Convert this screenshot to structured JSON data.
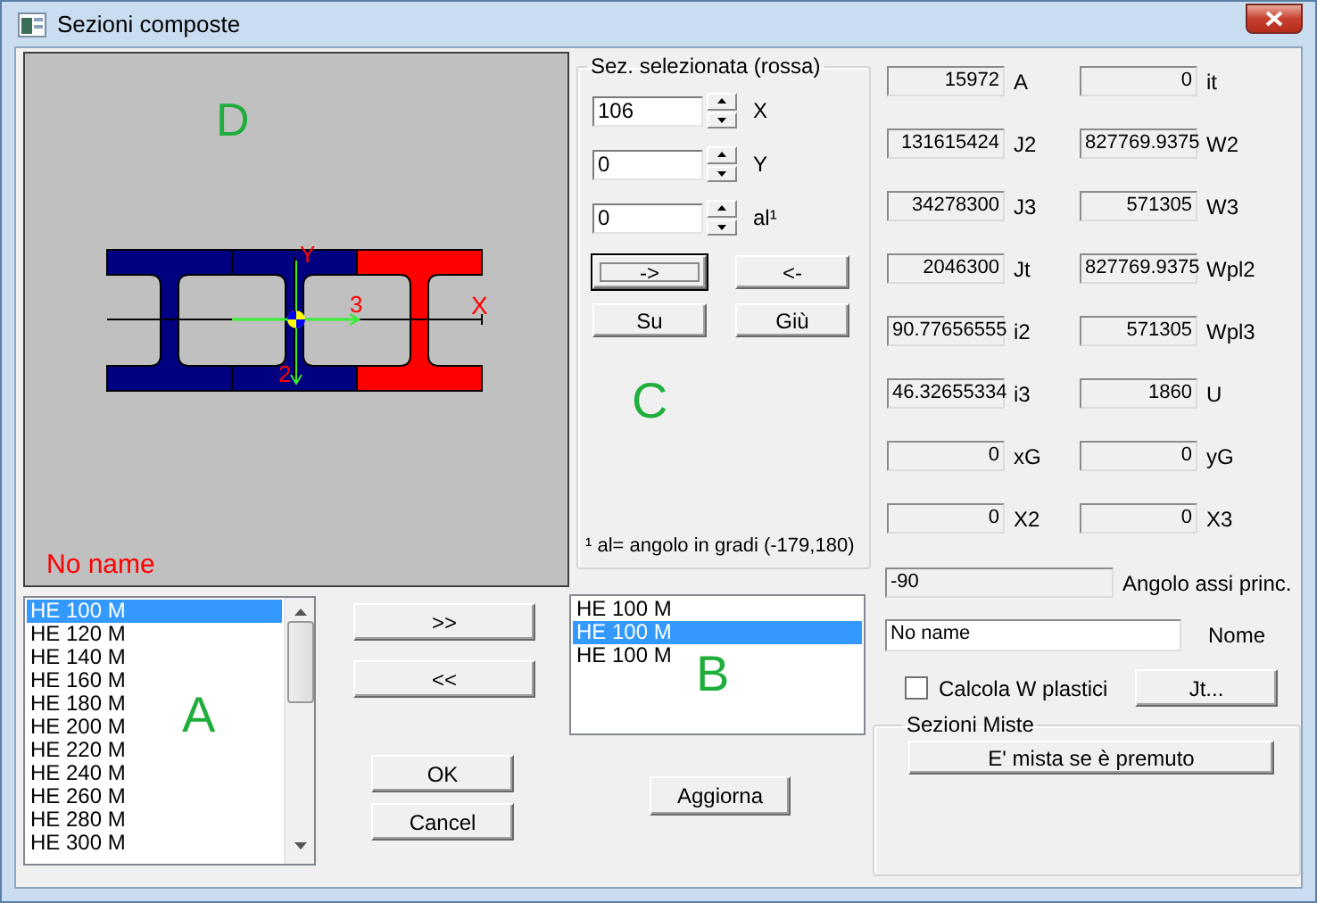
{
  "window": {
    "title": "Sezioni composte"
  },
  "drawing": {
    "letter": "D",
    "name": "No name",
    "axis_labels": {
      "x": "X",
      "y": "Y",
      "axis_3": "3",
      "axis_2": "2"
    },
    "sections": [
      {
        "selected": false
      },
      {
        "selected": false
      },
      {
        "selected": true
      }
    ]
  },
  "list_a": {
    "letter": "A",
    "items": [
      {
        "label": "HE 100 M",
        "selected": true
      },
      {
        "label": "HE 120 M",
        "selected": false
      },
      {
        "label": "HE 140 M",
        "selected": false
      },
      {
        "label": "HE 160 M",
        "selected": false
      },
      {
        "label": "HE 180 M",
        "selected": false
      },
      {
        "label": "HE 200 M",
        "selected": false
      },
      {
        "label": "HE 220 M",
        "selected": false
      },
      {
        "label": "HE 240 M",
        "selected": false
      },
      {
        "label": "HE 260 M",
        "selected": false
      },
      {
        "label": "HE 280 M",
        "selected": false
      },
      {
        "label": "HE 300 M",
        "selected": false
      }
    ]
  },
  "transfer_buttons": [
    ">>",
    "<<"
  ],
  "dialog_buttons": [
    "OK",
    "Cancel"
  ],
  "selected_section": {
    "title": "Sez. selezionata (rossa)",
    "fields": [
      {
        "value": "106",
        "label": "X"
      },
      {
        "value": "0",
        "label": "Y"
      },
      {
        "value": "0",
        "label": "al¹"
      }
    ],
    "buttons": [
      {
        "label": "->",
        "focused": true
      },
      {
        "label": "<-",
        "focused": false
      },
      {
        "label": "Su",
        "focused": false
      },
      {
        "label": "Giù",
        "focused": false
      }
    ],
    "letter": "C",
    "footnote": "¹ al= angolo in gradi (-179,180)"
  },
  "list_b": {
    "letter": "B",
    "items": [
      {
        "label": "HE 100 M",
        "selected": false
      },
      {
        "label": "HE 100 M",
        "selected": true
      },
      {
        "label": "HE 100 M",
        "selected": false
      }
    ]
  },
  "update_button": "Aggiorna",
  "properties": [
    {
      "value": "15972",
      "label": "A"
    },
    {
      "value": "0",
      "label": "it"
    },
    {
      "value": "131615424",
      "label": "J2"
    },
    {
      "value": "827769.9375",
      "label": "W2"
    },
    {
      "value": "34278300",
      "label": "J3"
    },
    {
      "value": "571305",
      "label": "W3"
    },
    {
      "value": "2046300",
      "label": "Jt"
    },
    {
      "value": "827769.9375",
      "label": "Wpl2"
    },
    {
      "value": "90.77656555",
      "label": "i2"
    },
    {
      "value": "571305",
      "label": "Wpl3"
    },
    {
      "value": "46.32655334",
      "label": "i3"
    },
    {
      "value": "1860",
      "label": "U"
    },
    {
      "value": "0",
      "label": "xG"
    },
    {
      "value": "0",
      "label": "yG"
    },
    {
      "value": "0",
      "label": "X2"
    },
    {
      "value": "0",
      "label": "X3"
    }
  ],
  "principal_angle": {
    "value": "-90",
    "label": "Angolo assi princ."
  },
  "name": {
    "value": "No name",
    "label": "Nome"
  },
  "plastic_checkbox": {
    "label": "Calcola W plastici",
    "checked": false
  },
  "jt_button": "Jt...",
  "mixed_sections": {
    "title": "Sezioni Miste",
    "button": "E' mista se è premuto"
  }
}
